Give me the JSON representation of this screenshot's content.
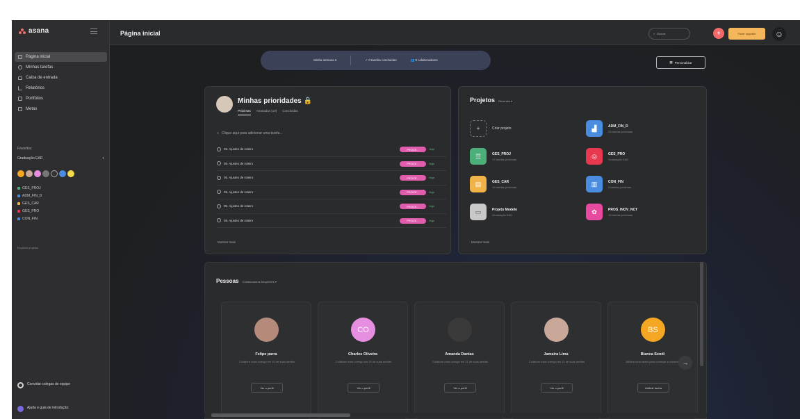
{
  "app": {
    "logo": "asana"
  },
  "topbar": {
    "page_title": "Página inicial",
    "search_placeholder": "Buscar",
    "add_label": "+",
    "upgrade_label": "Fazer upgrade"
  },
  "sidebar": {
    "items": [
      {
        "label": "Página inicial",
        "icon": "home-icon"
      },
      {
        "label": "Minhas tarefas",
        "icon": "check-circle-icon"
      },
      {
        "label": "Caixa de entrada",
        "icon": "bell-icon"
      },
      {
        "label": "Relatórios",
        "icon": "chart-icon"
      },
      {
        "label": "Portfólios",
        "icon": "folder-icon"
      },
      {
        "label": "Metas",
        "icon": "target-icon"
      }
    ],
    "section_label": "Favoritos",
    "team_name": "Graduação EAD",
    "team_add": "+",
    "projects": [
      {
        "name": "GES_PROJ",
        "color": "#4caf7a"
      },
      {
        "name": "ADM_FIN_D",
        "color": "#4a8de0"
      },
      {
        "name": "GES_CAR",
        "color": "#f0b34a"
      },
      {
        "name": "GES_PRO",
        "color": "#e8384f"
      },
      {
        "name": "CON_FIN",
        "color": "#4a8de0"
      }
    ],
    "browse": "Explorar projetos",
    "bottom": [
      {
        "label": "Convidar colegas de equipe"
      },
      {
        "label": "Ajuda e guia de introdução"
      }
    ]
  },
  "week_bar": {
    "selector": "Minha semana ▾",
    "completed": "✓ 0 tarefas concluídas",
    "collaborators": "👥 0 colaboradores"
  },
  "customize_label": "Personalizar",
  "priorities": {
    "title": "Minhas prioridades 🔒",
    "tabs": [
      "Próximas",
      "Atrasadas (10)",
      "Concluídas"
    ],
    "add_task": "Clique aqui para adicionar uma tarefa...",
    "tasks": [
      {
        "name": "05. Ajustes de roteiro",
        "tag": "PROCE...",
        "due": "Hoje"
      },
      {
        "name": "05. Ajustes de roteiro",
        "tag": "PROCE...",
        "due": "Hoje"
      },
      {
        "name": "05. Ajustes de roteiro",
        "tag": "PROCE...",
        "due": "Hoje"
      },
      {
        "name": "05. Ajustes de roteiro",
        "tag": "PROCE...",
        "due": "Hoje"
      },
      {
        "name": "05. Ajustes de roteiro",
        "tag": "PROCE...",
        "due": "Hoje"
      },
      {
        "name": "05. Ajustes de roteiro",
        "tag": "PROCE...",
        "due": "Hoje"
      }
    ],
    "more": "Mostrar mais"
  },
  "projects": {
    "title": "Projetos",
    "filter": "Recentes ▾",
    "create": "Criar projeto",
    "tiles": [
      {
        "name": "ADM_FIN_D",
        "sub": "23 tarefas próximas",
        "color": "#4a8de0",
        "glyph": "▟"
      },
      {
        "name": "GES_PROJ",
        "sub": "17 tarefas próximas",
        "color": "#4caf7a",
        "glyph": "☰"
      },
      {
        "name": "GES_PRO",
        "sub": "Graduação EAD",
        "color": "#e8384f",
        "glyph": "◎"
      },
      {
        "name": "GES_CAR",
        "sub": "19 tarefas próximas",
        "color": "#f0b34a",
        "glyph": "▤"
      },
      {
        "name": "CON_FIN",
        "sub": "3 tarefas próximas",
        "color": "#4a8de0",
        "glyph": "▥"
      },
      {
        "name": "Projeto Modelo",
        "sub": "Graduação EAD",
        "color": "#c8c8c8",
        "glyph": "▭"
      },
      {
        "name": "PROS_INOV_NCT",
        "sub": "18 tarefas próximas",
        "color": "#e84a9f",
        "glyph": "✿"
      }
    ],
    "more": "Mostrar mais"
  },
  "people": {
    "title": "Pessoas",
    "filter": "Colaboradores frequentes ▾",
    "list": [
      {
        "name": "Felipe parra",
        "desc": "Colabore mais comigo em 10 de suas tarefas",
        "initials": "",
        "color": "#b58a7a",
        "btn": "Ver o perfil"
      },
      {
        "name": "Charles Oliveira",
        "desc": "Colabore mais comigo em 20 de suas tarefas",
        "initials": "CO",
        "color": "#e68ee0",
        "btn": "Ver o perfil"
      },
      {
        "name": "Amanda Dantas",
        "desc": "Colabore mais comigo em 11 de suas tarefas",
        "initials": "",
        "color": "#3a3a3a",
        "btn": "Ver o perfil"
      },
      {
        "name": "Jamaira Lima",
        "desc": "Colabore mais comigo em 11 de suas tarefas",
        "initials": "",
        "color": "#c9a89a",
        "btn": "Ver o perfil"
      },
      {
        "name": "Bianca Sendi",
        "desc": "Atribua uma tarefa para começar a colaborar",
        "initials": "BS",
        "color": "#f5a623",
        "btn": "Atribuir tarefa"
      }
    ]
  }
}
